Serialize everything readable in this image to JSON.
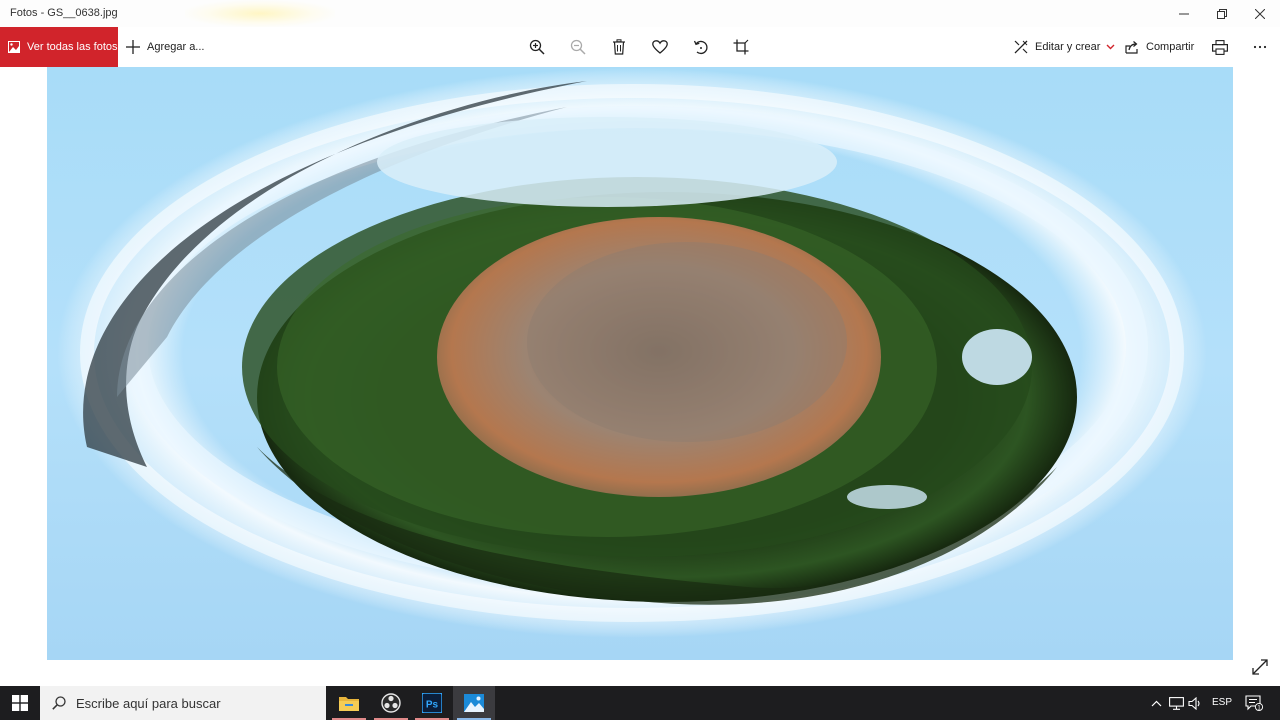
{
  "window": {
    "title": "Fotos - GS__0638.jpg",
    "controls": [
      "minimize-icon",
      "maximize-icon",
      "close-icon"
    ]
  },
  "toolbar": {
    "view_all_label": "Ver todas las fotos",
    "add_label": "Agregar a...",
    "edit_label": "Editar y crear",
    "share_label": "Compartir",
    "icons": [
      "zoom-in-icon",
      "zoom-out-icon",
      "delete-icon",
      "heart-icon",
      "rotate-icon",
      "crop-icon",
      "print-icon",
      "more-icon"
    ]
  },
  "viewer": {
    "image_kind": "little-planet-panorama"
  },
  "taskbar": {
    "search_placeholder": "Escribe aquí para buscar",
    "apps": [
      "file-explorer-icon",
      "obs-icon",
      "photoshop-icon",
      "photos-icon"
    ],
    "photoshop_label": "Ps",
    "language": "ESP",
    "notification_count": "1"
  },
  "colors": {
    "accent": "#d1242b",
    "taskbar": "#1d1d1f",
    "sky": "#a8dcf8"
  }
}
